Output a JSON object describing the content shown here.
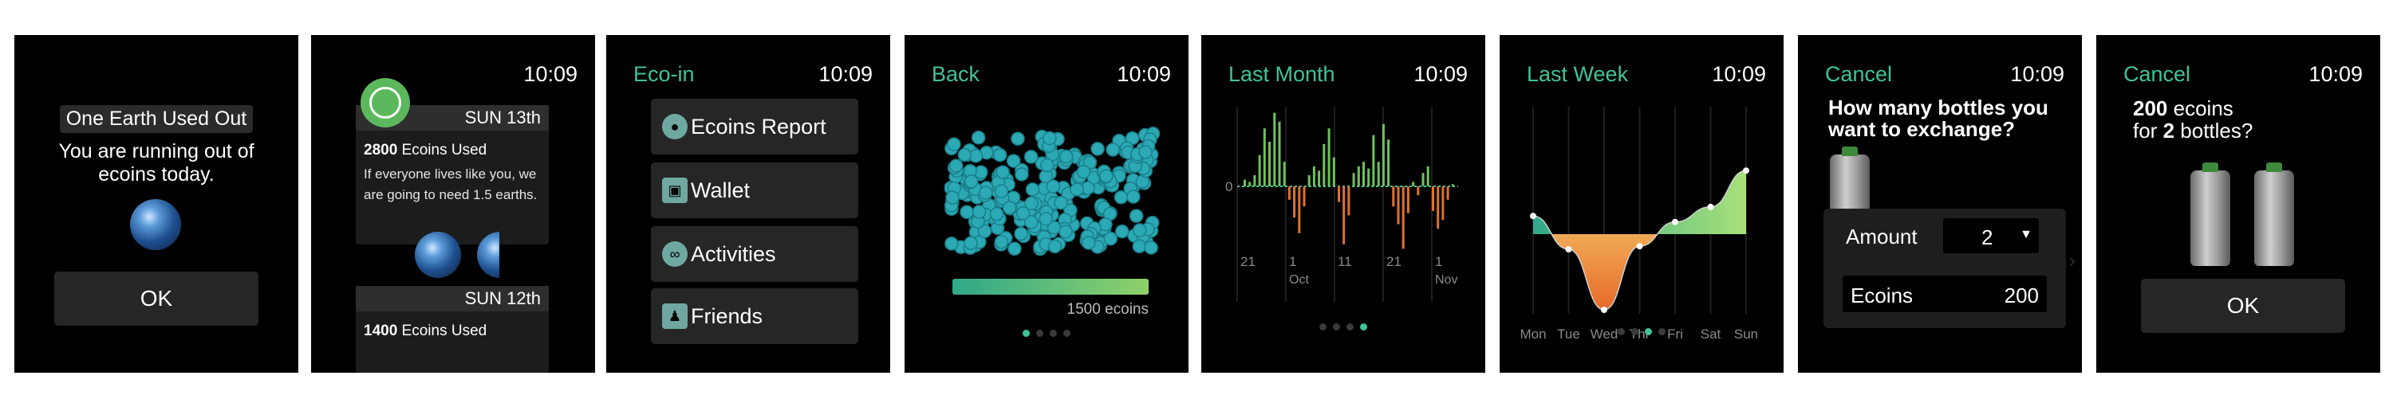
{
  "screen1": {
    "title": "One Earth Used Out",
    "message": "You are running out of ecoins today.",
    "ok": "OK"
  },
  "screen2": {
    "time": "10:09",
    "day1": {
      "date": "SUN 13th",
      "used_value": "2800",
      "used_label": "Ecoins Used",
      "note": "If everyone lives like you, we are going to need 1.5 earths."
    },
    "day2": {
      "date": "SUN 12th",
      "used_value": "1400",
      "used_label": "Ecoins Used"
    }
  },
  "screen3": {
    "title": "Eco-in",
    "time": "10:09",
    "menu": [
      {
        "label": "Ecoins Report",
        "icon": "globe-icon"
      },
      {
        "label": "Wallet",
        "icon": "wallet-icon"
      },
      {
        "label": "Activities",
        "icon": "binoculars-icon"
      },
      {
        "label": "Friends",
        "icon": "friends-icon"
      }
    ]
  },
  "screen4": {
    "back": "Back",
    "time": "10:09",
    "ecoins": "1500 ecoins",
    "progress": 1.0
  },
  "screen5": {
    "title": "Last Month",
    "time": "10:09",
    "zero": "0",
    "ticks": [
      {
        "num": "21",
        "month": ""
      },
      {
        "num": "1",
        "month": "Oct"
      },
      {
        "num": "11",
        "month": ""
      },
      {
        "num": "21",
        "month": ""
      },
      {
        "num": "1",
        "month": "Nov"
      }
    ]
  },
  "screen6": {
    "title": "Last Week",
    "time": "10:09",
    "days": [
      "Mon",
      "Tue",
      "Wed",
      "Thr",
      "Fri",
      "Sat",
      "Sun"
    ]
  },
  "screen7": {
    "cancel": "Cancel",
    "time": "10:09",
    "question": "How many bottles you want to exchange?",
    "amount_label": "Amount",
    "amount_value": "2",
    "ecoins_label": "Ecoins",
    "ecoins_value": "200"
  },
  "screen8": {
    "cancel": "Cancel",
    "time": "10:09",
    "ecoins": "200",
    "ecoins_word": "ecoins",
    "for_word": "for",
    "bottles": "2",
    "bottles_word": "bottles?",
    "ok": "OK"
  },
  "chart_data": [
    {
      "type": "bar",
      "title": "Last Month",
      "values": [
        0.3,
        0.2,
        0.5,
        1.4,
        2.6,
        2.0,
        3.3,
        2.9,
        1.1,
        -0.6,
        -1.4,
        -2.1,
        -0.9,
        0.5,
        0.9,
        0.7,
        1.9,
        2.6,
        1.3,
        -0.7,
        -2.6,
        -1.3,
        0.6,
        0.9,
        1.1,
        0.8,
        2.3,
        1.1,
        2.8,
        2.1,
        -0.9,
        -1.7,
        -2.8,
        -1.2,
        0.2,
        -0.4,
        0.6,
        0.9,
        -1.1,
        -1.9,
        -1.5,
        -0.6,
        0.1
      ],
      "ticks": [
        "21",
        "1 Oct",
        "11",
        "21",
        "1 Nov"
      ]
    },
    {
      "type": "area",
      "title": "Last Week",
      "categories": [
        "Mon",
        "Tue",
        "Wed",
        "Thr",
        "Fri",
        "Sat",
        "Sun"
      ],
      "values": [
        0.6,
        -0.5,
        -2.5,
        -0.4,
        0.4,
        0.9,
        2.1
      ]
    }
  ]
}
